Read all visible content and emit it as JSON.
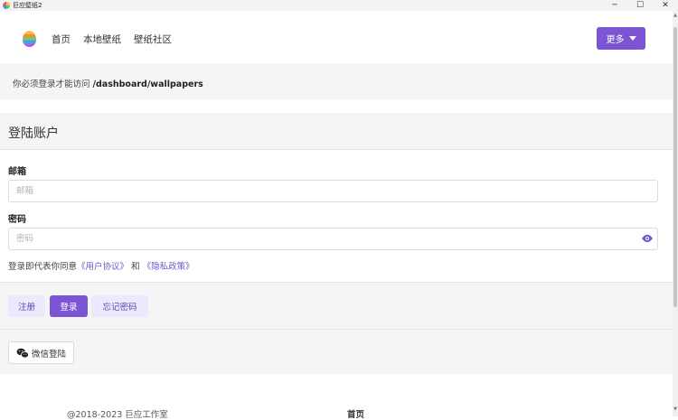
{
  "window": {
    "title": "巨应壁纸2",
    "controls": {
      "minimize": "─",
      "maximize": "☐",
      "close": "✕"
    }
  },
  "nav": {
    "links": [
      "首页",
      "本地壁纸",
      "壁纸社区"
    ],
    "more_label": "更多"
  },
  "notice": {
    "text": "你必须登录才能访问",
    "path": "/dashboard/wallpapers"
  },
  "login": {
    "header": "登陆账户",
    "email_label": "邮箱",
    "email_placeholder": "邮箱",
    "password_label": "密码",
    "password_placeholder": "密码",
    "agree_prefix": "登录即代表你同意",
    "agree_user_agreement": "《用户协议》",
    "agree_and": "和",
    "agree_privacy": "《隐私政策》",
    "register_label": "注册",
    "login_label": "登录",
    "forgot_label": "忘记密码",
    "wechat_label": "微信登陆"
  },
  "footer": {
    "copyright": "@2018-2023 巨应工作室",
    "home": "首页"
  },
  "colors": {
    "accent": "#7b55d3",
    "accent_light": "#ebe9fb",
    "link": "#6f58c9"
  },
  "icons": {
    "logo": "app-logo-icon",
    "dropdown": "caret-down-icon",
    "password_toggle": "eye-icon",
    "wechat": "wechat-icon"
  }
}
